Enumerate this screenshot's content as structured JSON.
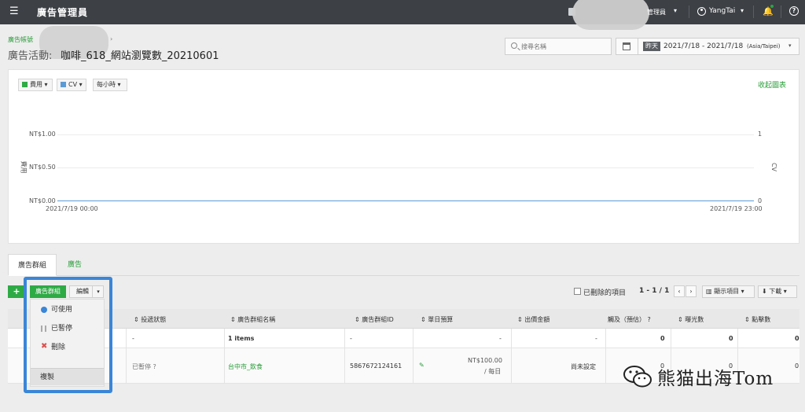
{
  "topbar": {
    "app_name": "廣告管理員",
    "admin_label": "管理員",
    "user_name": "YangTai"
  },
  "breadcrumb": {
    "text": "廣告帳號"
  },
  "title": {
    "prefix": "廣告活動:",
    "name": "咖啡_618_網站瀏覽數_20210601"
  },
  "search": {
    "placeholder": "搜尋名稱"
  },
  "date": {
    "today_badge": "昨天",
    "range": "2021/7/18 - 2021/7/18",
    "timezone": "(Asia/Taipei)"
  },
  "chart_controls": {
    "metric1": "費用",
    "metric1_color": "#2eaa45",
    "metric2": "CV",
    "metric2_color": "#5b9bd5",
    "interval": "每小時",
    "collapse": "收起圖表"
  },
  "chart_data": {
    "type": "line",
    "x_labels": [
      "2021/7/19 00:00",
      "2021/7/19 23:00"
    ],
    "left_axis": {
      "label": "費用",
      "ticks": [
        "NT$1.00",
        "NT$0.50",
        "NT$0.00"
      ]
    },
    "right_axis": {
      "label": "CV",
      "ticks": [
        "1",
        "0"
      ]
    },
    "series": [
      {
        "name": "費用",
        "values": [
          0,
          0
        ]
      },
      {
        "name": "CV",
        "values": [
          0,
          0
        ]
      }
    ],
    "ylim": [
      0,
      1
    ],
    "grid": true
  },
  "tabs": [
    {
      "label": "廣告群組"
    },
    {
      "label": "廣告"
    }
  ],
  "toolbar": {
    "add_group": "廣告群組",
    "edit": "編輯",
    "show_deleted": "已刪除的項目",
    "pager": "1 - 1 / 1",
    "columns": "顯示項目",
    "download": "下載"
  },
  "menu": {
    "items": [
      {
        "label": "可使用",
        "icon": "active-dot-icon",
        "color": "#3a86d8"
      },
      {
        "label": "已暫停",
        "icon": "pause-icon",
        "color": "#aaaaaa"
      },
      {
        "label": "刪除",
        "icon": "delete-x-icon",
        "color": "#d9534f"
      }
    ],
    "copy": "複製"
  },
  "table": {
    "headers": [
      "投遞狀態",
      "廣告群組名稱",
      "廣告群組ID",
      "單日預算",
      "出價金額",
      "觸及（預估）",
      "曝光數",
      "點擊數"
    ],
    "summary": {
      "status": "-",
      "name": "1 items",
      "id": "-",
      "budget": "-",
      "bid": "-",
      "reach": "0",
      "impressions": "0",
      "clicks": "0"
    },
    "rows": [
      {
        "status": "已暫停",
        "name": "台中市_飲食",
        "id": "5867672124161",
        "budget": "NT$100.00",
        "budget_unit": "/ 每日",
        "bid": "尚未設定",
        "reach": "0",
        "impressions": "0",
        "clicks": "0"
      }
    ]
  },
  "watermark": {
    "text": "熊猫出海Tom"
  }
}
